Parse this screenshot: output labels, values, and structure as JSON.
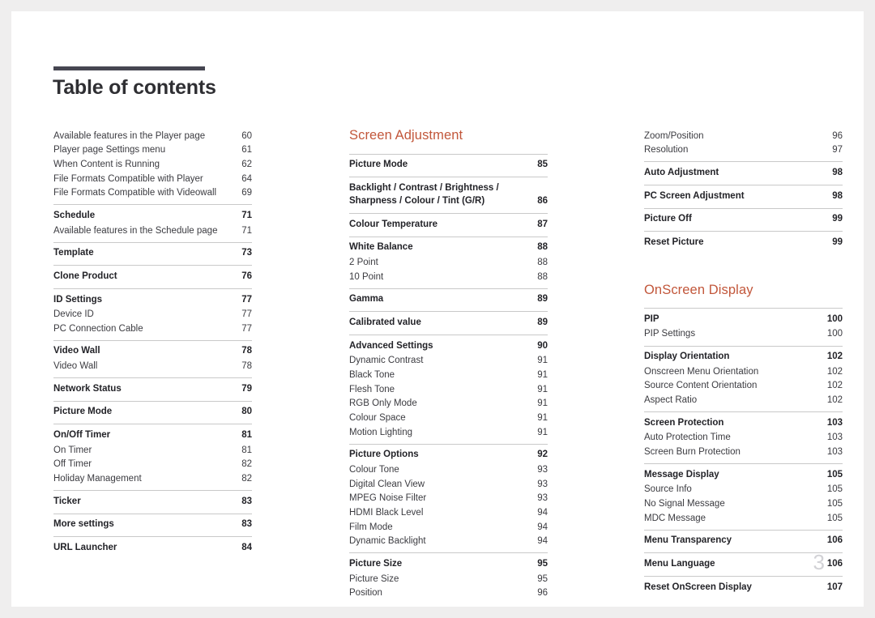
{
  "document": {
    "title": "Table of contents",
    "folio": "3"
  },
  "colors": {
    "accent": "#c2573b",
    "rule": "#464651",
    "divider": "#c9c9c9",
    "page_background": "#ffffff",
    "outer_background": "#efeeee",
    "folio": "#d2d2d6"
  },
  "columns": [
    {
      "name": "left",
      "heading": null,
      "groups": [
        {
          "rule": false,
          "rows": [
            {
              "level": 2,
              "label": "Available features in the Player page",
              "page": "60"
            },
            {
              "level": 2,
              "label": "Player page Settings menu",
              "page": "61"
            },
            {
              "level": 2,
              "label": "When Content is Running",
              "page": "62"
            },
            {
              "level": 2,
              "label": "File Formats Compatible with Player",
              "page": "64"
            },
            {
              "level": 2,
              "label": "File Formats Compatible with Videowall",
              "page": "69"
            }
          ]
        },
        {
          "rule": true,
          "rows": [
            {
              "level": 1,
              "label": "Schedule",
              "page": "71"
            },
            {
              "level": 2,
              "label": "Available features in the Schedule page",
              "page": "71"
            }
          ]
        },
        {
          "rule": true,
          "rows": [
            {
              "level": 1,
              "label": "Template",
              "page": "73"
            }
          ]
        },
        {
          "rule": true,
          "rows": [
            {
              "level": 1,
              "label": "Clone Product",
              "page": "76"
            }
          ]
        },
        {
          "rule": true,
          "rows": [
            {
              "level": 1,
              "label": "ID Settings",
              "page": "77"
            },
            {
              "level": 2,
              "label": "Device ID",
              "page": "77"
            },
            {
              "level": 2,
              "label": "PC Connection Cable",
              "page": "77"
            }
          ]
        },
        {
          "rule": true,
          "rows": [
            {
              "level": 1,
              "label": "Video Wall",
              "page": "78"
            },
            {
              "level": 2,
              "label": "Video Wall",
              "page": "78"
            }
          ]
        },
        {
          "rule": true,
          "rows": [
            {
              "level": 1,
              "label": "Network Status",
              "page": "79"
            }
          ]
        },
        {
          "rule": true,
          "rows": [
            {
              "level": 1,
              "label": "Picture Mode",
              "page": "80"
            }
          ]
        },
        {
          "rule": true,
          "rows": [
            {
              "level": 1,
              "label": "On/Off Timer",
              "page": "81"
            },
            {
              "level": 2,
              "label": "On Timer",
              "page": "81"
            },
            {
              "level": 2,
              "label": "Off Timer",
              "page": "82"
            },
            {
              "level": 2,
              "label": "Holiday Management",
              "page": "82"
            }
          ]
        },
        {
          "rule": true,
          "rows": [
            {
              "level": 1,
              "label": "Ticker",
              "page": "83"
            }
          ]
        },
        {
          "rule": true,
          "rows": [
            {
              "level": 1,
              "label": "More settings",
              "page": "83"
            }
          ]
        },
        {
          "rule": true,
          "rows": [
            {
              "level": 1,
              "label": "URL Launcher",
              "page": "84"
            }
          ]
        }
      ]
    },
    {
      "name": "middle",
      "heading": "Screen Adjustment",
      "groups": [
        {
          "rule": true,
          "rows": [
            {
              "level": 1,
              "label": "Picture Mode",
              "page": "85"
            }
          ]
        },
        {
          "rule": true,
          "rows": [
            {
              "level": 1,
              "label": "Backlight / Contrast / Brightness /",
              "label2": "Sharpness / Colour / Tint (G/R)",
              "page": "86"
            }
          ]
        },
        {
          "rule": true,
          "rows": [
            {
              "level": 1,
              "label": "Colour Temperature",
              "page": "87"
            }
          ]
        },
        {
          "rule": true,
          "rows": [
            {
              "level": 1,
              "label": "White Balance",
              "page": "88"
            },
            {
              "level": 2,
              "label": "2 Point",
              "page": "88"
            },
            {
              "level": 2,
              "label": "10 Point",
              "page": "88"
            }
          ]
        },
        {
          "rule": true,
          "rows": [
            {
              "level": 1,
              "label": "Gamma",
              "page": "89"
            }
          ]
        },
        {
          "rule": true,
          "rows": [
            {
              "level": 1,
              "label": "Calibrated value",
              "page": "89"
            }
          ]
        },
        {
          "rule": true,
          "rows": [
            {
              "level": 1,
              "label": "Advanced Settings",
              "page": "90"
            },
            {
              "level": 2,
              "label": "Dynamic Contrast",
              "page": "91"
            },
            {
              "level": 2,
              "label": "Black Tone",
              "page": "91"
            },
            {
              "level": 2,
              "label": "Flesh Tone",
              "page": "91"
            },
            {
              "level": 2,
              "label": "RGB Only Mode",
              "page": "91"
            },
            {
              "level": 2,
              "label": "Colour Space",
              "page": "91"
            },
            {
              "level": 2,
              "label": "Motion Lighting",
              "page": "91"
            }
          ]
        },
        {
          "rule": true,
          "rows": [
            {
              "level": 1,
              "label": "Picture Options",
              "page": "92"
            },
            {
              "level": 2,
              "label": "Colour Tone",
              "page": "93"
            },
            {
              "level": 2,
              "label": "Digital Clean View",
              "page": "93"
            },
            {
              "level": 2,
              "label": "MPEG Noise Filter",
              "page": "93"
            },
            {
              "level": 2,
              "label": "HDMI Black Level",
              "page": "94"
            },
            {
              "level": 2,
              "label": "Film Mode",
              "page": "94"
            },
            {
              "level": 2,
              "label": "Dynamic Backlight",
              "page": "94"
            }
          ]
        },
        {
          "rule": true,
          "rows": [
            {
              "level": 1,
              "label": "Picture Size",
              "page": "95"
            },
            {
              "level": 2,
              "label": "Picture Size",
              "page": "95"
            },
            {
              "level": 2,
              "label": "Position",
              "page": "96"
            }
          ]
        }
      ]
    },
    {
      "name": "right",
      "heading": null,
      "groups": [
        {
          "rule": false,
          "rows": [
            {
              "level": 2,
              "label": "Zoom/Position",
              "page": "96"
            },
            {
              "level": 2,
              "label": "Resolution",
              "page": "97"
            }
          ]
        },
        {
          "rule": true,
          "rows": [
            {
              "level": 1,
              "label": "Auto Adjustment",
              "page": "98"
            }
          ]
        },
        {
          "rule": true,
          "rows": [
            {
              "level": 1,
              "label": "PC Screen Adjustment",
              "page": "98"
            }
          ]
        },
        {
          "rule": true,
          "rows": [
            {
              "level": 1,
              "label": "Picture Off",
              "page": "99"
            }
          ]
        },
        {
          "rule": true,
          "rows": [
            {
              "level": 1,
              "label": "Reset Picture",
              "page": "99"
            }
          ]
        }
      ],
      "heading2": "OnScreen Display",
      "groups2": [
        {
          "rule": true,
          "rows": [
            {
              "level": 1,
              "label": "PIP",
              "page": "100"
            },
            {
              "level": 2,
              "label": "PIP Settings",
              "page": "100"
            }
          ]
        },
        {
          "rule": true,
          "rows": [
            {
              "level": 1,
              "label": "Display Orientation",
              "page": "102"
            },
            {
              "level": 2,
              "label": "Onscreen Menu Orientation",
              "page": "102"
            },
            {
              "level": 2,
              "label": "Source Content Orientation",
              "page": "102"
            },
            {
              "level": 2,
              "label": "Aspect Ratio",
              "page": "102"
            }
          ]
        },
        {
          "rule": true,
          "rows": [
            {
              "level": 1,
              "label": "Screen Protection",
              "page": "103"
            },
            {
              "level": 2,
              "label": "Auto Protection Time",
              "page": "103"
            },
            {
              "level": 2,
              "label": "Screen Burn Protection",
              "page": "103"
            }
          ]
        },
        {
          "rule": true,
          "rows": [
            {
              "level": 1,
              "label": "Message Display",
              "page": "105"
            },
            {
              "level": 2,
              "label": "Source Info",
              "page": "105"
            },
            {
              "level": 2,
              "label": "No Signal Message",
              "page": "105"
            },
            {
              "level": 2,
              "label": "MDC Message",
              "page": "105"
            }
          ]
        },
        {
          "rule": true,
          "rows": [
            {
              "level": 1,
              "label": "Menu Transparency",
              "page": "106"
            }
          ]
        },
        {
          "rule": true,
          "rows": [
            {
              "level": 1,
              "label": "Menu Language",
              "page": "106"
            }
          ]
        },
        {
          "rule": true,
          "rows": [
            {
              "level": 1,
              "label": "Reset OnScreen Display",
              "page": "107"
            }
          ]
        }
      ]
    }
  ]
}
